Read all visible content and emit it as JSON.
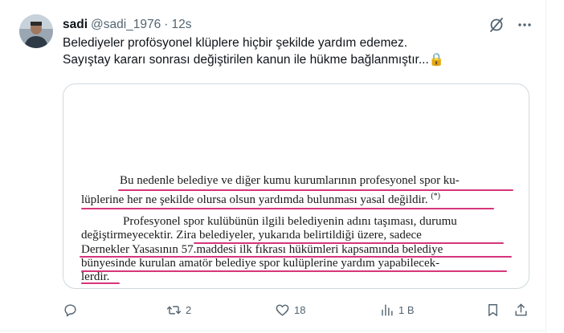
{
  "tweet": {
    "author_name": "sadi",
    "author_handle": "@sadi_1976",
    "separator": "·",
    "time": "12s",
    "text_line1": "Belediyeler profösyonel klüplere hiçbir şekilde yardım edemez.",
    "text_line2": "Sayıştay kararı sonrası değiştirilen kanun ile hükme bağlanmıştır...",
    "text_emoji": "🔒"
  },
  "document": {
    "line1": "Bu nedenle belediye ve diğer kumu kurumlarının profesyonel spor ku-",
    "line2": "lüplerine her ne şekilde olursa olsun yardımda bulunması yasal değildir.",
    "line2_footnote": "(*)",
    "line3": "Profesyonel spor kulübünün ilgili belediyenin adını taşıması, durumu",
    "line4": "değiştirmeyecektir. Zira belediyeler, yukarıda belirtildiği üzere, sadece",
    "line5": "Dernekler Yasasının 57.maddesi ilk fıkrası hükümleri kapsamında belediye",
    "line6": "bünyesinde kurulan amatör belediye spor kulüplerine yardım yapabilecek-",
    "line7": "lerdir."
  },
  "actions": {
    "reply_count": "",
    "retweet_count": "2",
    "like_count": "18",
    "views_count": "1 B"
  },
  "colors": {
    "highlight": "#d6357a",
    "secondary_text": "#536471"
  }
}
